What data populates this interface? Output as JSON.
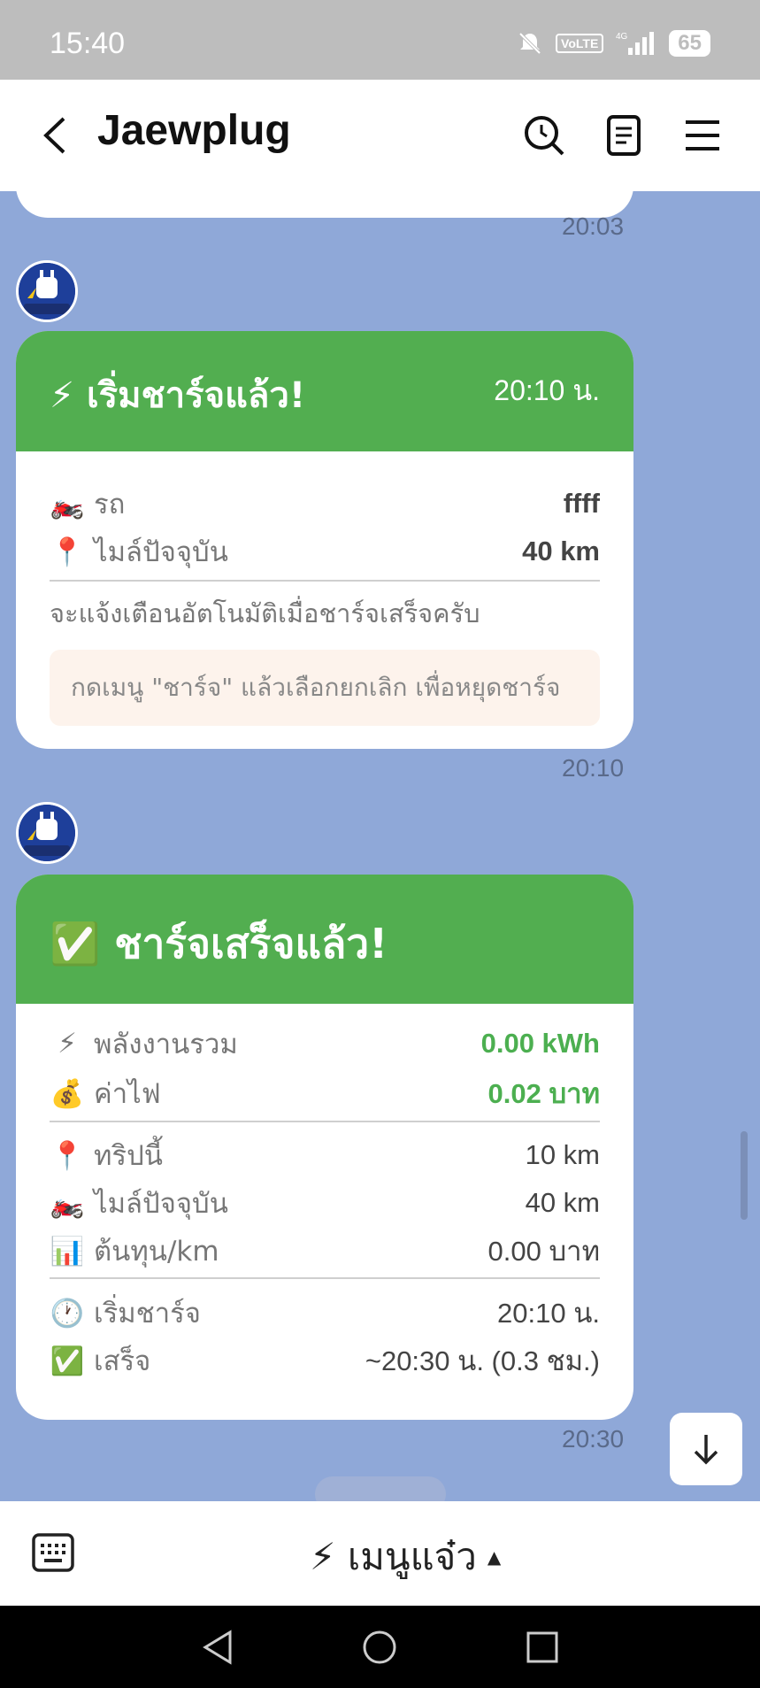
{
  "status_bar": {
    "time": "15:40",
    "network": "VoLTE",
    "signal": "4G",
    "battery": "65"
  },
  "header": {
    "back_icon": "chevron-left-icon",
    "title": "Jaewplug"
  },
  "messages": {
    "prev_timestamp": "20:03",
    "card1": {
      "title": "⚡ เริ่มชาร์จแล้ว!",
      "time": "20:10 น.",
      "rows": [
        {
          "emoji": "🏍️",
          "label": "รถ",
          "value": "ffff"
        },
        {
          "emoji": "📍",
          "label": "ไมล์ปัจจุบัน",
          "value": "40 km"
        }
      ],
      "note": "จะแจ้งเตือนอัตโนมัติเมื่อชาร์จเสร็จครับ",
      "hint": "กดเมนู \"ชาร์จ\" แล้วเลือกยกเลิก เพื่อหยุดชาร์จ",
      "timestamp": "20:10"
    },
    "card2": {
      "title": "✅ ชาร์จเสร็จแล้ว!",
      "summary_rows": [
        {
          "emoji": "⚡",
          "label": "พลังงานรวม",
          "value": "0.00 kWh"
        },
        {
          "emoji": "💰",
          "label": "ค่าไฟ",
          "value": "0.02 บาท"
        }
      ],
      "trip_rows": [
        {
          "emoji": "📍",
          "label": "ทริปนี้",
          "value": "10 km"
        },
        {
          "emoji": "🏍️",
          "label": "ไมล์ปัจจุบัน",
          "value": "40 km"
        },
        {
          "emoji": "📊",
          "label": "ต้นทุน/km",
          "value": "0.00 บาท"
        }
      ],
      "time_rows": [
        {
          "emoji": "🕐",
          "label": "เริ่มชาร์จ",
          "value": "20:10 น."
        },
        {
          "emoji": "✅",
          "label": "เสร็จ",
          "value": "~20:30 น. (0.3 ชม.)"
        }
      ],
      "timestamp": "20:30"
    }
  },
  "bottom_bar": {
    "menu_label": "⚡ เมนูแจ๋ว",
    "caret": "▲"
  },
  "colors": {
    "accent_green": "#52ae50",
    "chat_bg": "#8fa8d8"
  }
}
